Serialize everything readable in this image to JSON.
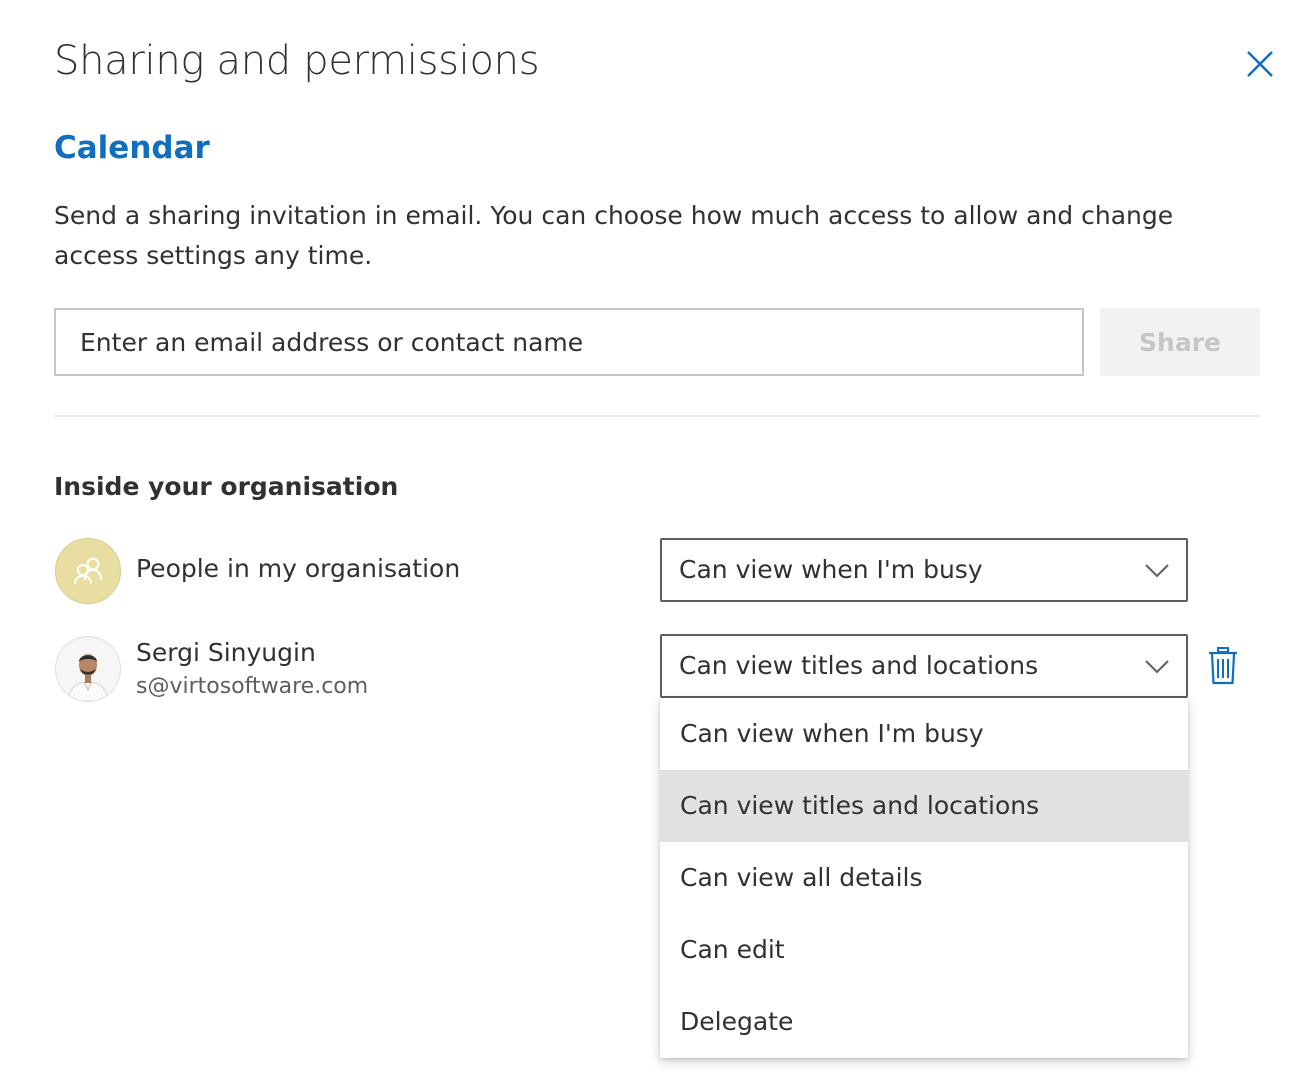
{
  "dialog": {
    "title": "Sharing and permissions",
    "calendar_name": "Calendar",
    "description": "Send a sharing invitation in email. You can choose how much access to allow and change access settings any time.",
    "email_placeholder": "Enter an email address or contact name",
    "share_label": "Share"
  },
  "section": {
    "heading": "Inside your organisation"
  },
  "rows": [
    {
      "name": "People in my organisation",
      "permission": "Can view when I'm busy",
      "avatar_icon": "people-group-icon"
    },
    {
      "name": "Sergi Sinyugin",
      "email": "s@virtosoftware.com",
      "permission": "Can view titles and locations",
      "avatar_icon": "user-photo"
    }
  ],
  "permission_menu": {
    "options": [
      "Can view when I'm busy",
      "Can view titles and locations",
      "Can view all details",
      "Can edit",
      "Delegate"
    ],
    "selected": "Can view titles and locations"
  },
  "colors": {
    "accent": "#106ebe",
    "group_avatar_bg": "#e9dea2",
    "selected_item_bg": "#e1e1e1",
    "share_disabled_bg": "#f3f2f1"
  },
  "icons": {
    "close": "close-icon",
    "chevron": "chevron-down-icon",
    "delete": "trash-icon"
  }
}
